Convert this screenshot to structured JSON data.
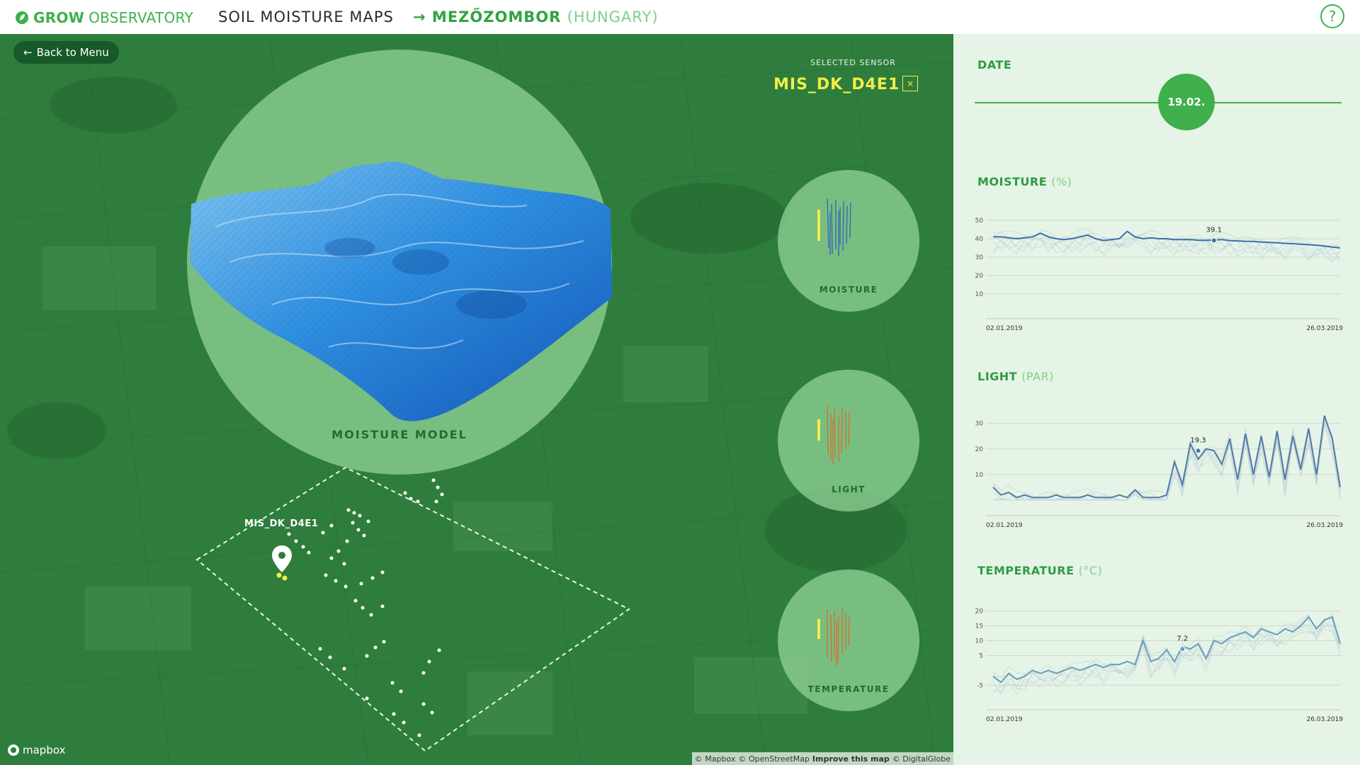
{
  "header": {
    "brand_bold": "GROW",
    "brand_light": "OBSERVATORY",
    "app_title": "SOIL MOISTURE MAPS",
    "location_arrow": "→",
    "location_name": "MEZŐZOMBOR",
    "location_country": "(HUNGARY)",
    "help_label": "?"
  },
  "map": {
    "back_label": "Back to Menu",
    "selected_sensor_label": "SELECTED SENSOR",
    "selected_sensor_value": "MIS_DK_D4E1",
    "deselect_label": "×",
    "model_label": "MOISTURE MODEL",
    "sensor_callout": "MIS_DK_D4E1",
    "mini_circles": [
      {
        "label": "MOISTURE"
      },
      {
        "label": "LIGHT"
      },
      {
        "label": "TEMPERATURE"
      }
    ],
    "mapbox_label": "mapbox",
    "attribution": {
      "mapbox": "© Mapbox",
      "osm": "© OpenStreetMap",
      "improve": "Improve this map",
      "digitalglobe": "© DigitalGlobe"
    }
  },
  "panel": {
    "date_title": "DATE",
    "date_value": "19.02.",
    "moisture_title": "MOISTURE",
    "moisture_unit": "(%)",
    "light_title": "LIGHT",
    "light_unit": "(PAR)",
    "temperature_title": "TEMPERATURE",
    "temperature_unit": "(°C)"
  },
  "colors": {
    "brand_green": "#3fb04b",
    "sensor_yellow": "#f3ed4a",
    "moisture_line": "#3d6fae",
    "light_line": "#d4a02e",
    "temp_line": "#d4a02e"
  },
  "chart_data": [
    {
      "type": "line",
      "title": "MOISTURE (%)",
      "x_start": "02.01.2019",
      "x_end": "26.03.2019",
      "yticks": [
        10,
        20,
        30,
        40,
        50
      ],
      "ylim": [
        5,
        55
      ],
      "marker_label": "39.1",
      "marker_value": 39.1,
      "marker_index": 28,
      "series": [
        {
          "values": [
            41,
            41,
            40.5,
            40,
            40.5,
            41,
            43,
            41,
            40,
            39.5,
            40,
            41,
            42,
            40,
            39,
            39.5,
            40,
            44,
            41,
            40,
            40.5,
            40,
            40,
            39.5,
            39.5,
            39.5,
            39.2,
            39.1,
            39.3,
            39.5,
            39,
            38.8,
            38.6,
            38.5,
            38.2,
            38,
            37.8,
            37.5,
            37.3,
            37,
            36.8,
            36.5,
            36,
            35.5,
            35
          ]
        }
      ]
    },
    {
      "type": "line",
      "title": "LIGHT (PAR)",
      "x_start": "02.01.2019",
      "x_end": "26.03.2019",
      "yticks": [
        10,
        20,
        30
      ],
      "ylim": [
        0,
        36
      ],
      "marker_label": "19.3",
      "marker_value": 19.3,
      "marker_index": 26,
      "series": [
        {
          "values": [
            5,
            2,
            3,
            1,
            2,
            1,
            1,
            1,
            2,
            1,
            1,
            1,
            2,
            1,
            1,
            1,
            2,
            1,
            4,
            1,
            1,
            1,
            2,
            15,
            6,
            22,
            16,
            20,
            19.3,
            14,
            24,
            8,
            26,
            10,
            25,
            9,
            27,
            8,
            25,
            12,
            28,
            10,
            33,
            24,
            5
          ]
        }
      ]
    },
    {
      "type": "line",
      "title": "TEMPERATURE (°C)",
      "x_start": "02.01.2019",
      "x_end": "26.03.2019",
      "yticks": [
        -5,
        5,
        10,
        15,
        20
      ],
      "ylim": [
        -8,
        23
      ],
      "marker_label": "7.2",
      "marker_value": 7.2,
      "marker_index": 24,
      "series": [
        {
          "values": [
            -2,
            -4,
            -1,
            -3,
            -2,
            0,
            -1,
            0,
            -1,
            0,
            1,
            0,
            1,
            2,
            1,
            2,
            2,
            3,
            2,
            10,
            3,
            4,
            7,
            3,
            8,
            7.2,
            9,
            4,
            10,
            9,
            11,
            12,
            13,
            11,
            14,
            13,
            12,
            14,
            13,
            15,
            18,
            14,
            17,
            18,
            9
          ]
        }
      ]
    }
  ]
}
